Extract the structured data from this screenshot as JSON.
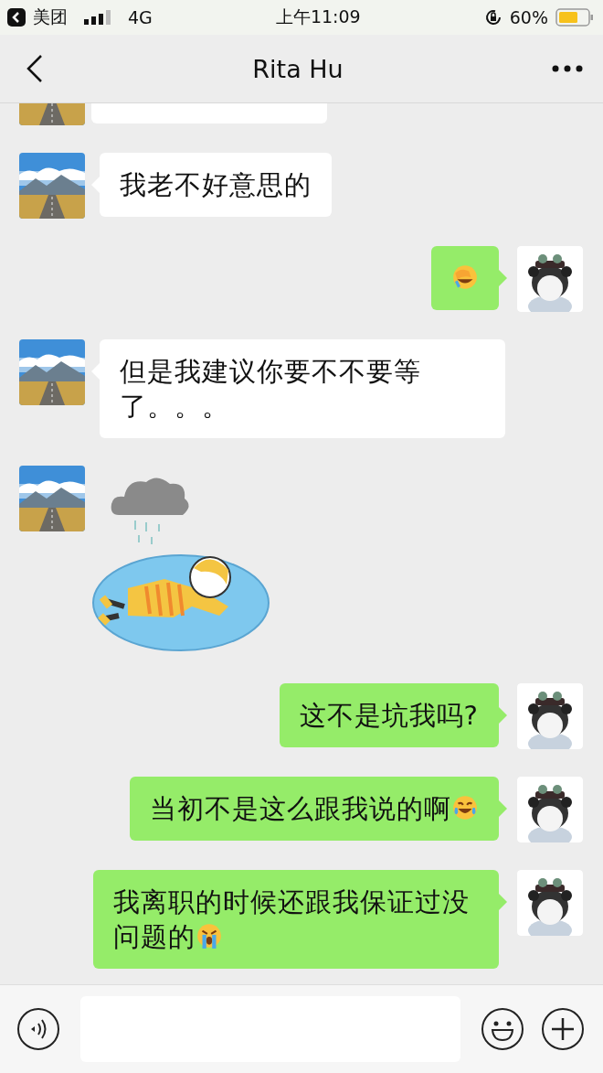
{
  "status_bar": {
    "back_app": "美团",
    "network": "4G",
    "time": "上午11:09",
    "battery": "60%"
  },
  "header": {
    "title": "Rita Hu"
  },
  "messages": [
    {
      "outgoing": false,
      "kind": "cut_off"
    },
    {
      "outgoing": false,
      "kind": "text",
      "text": "我老不好意思的"
    },
    {
      "outgoing": true,
      "kind": "text",
      "emoji": {
        "kind": "facepalm"
      }
    },
    {
      "outgoing": false,
      "kind": "text",
      "text": "但是我建议你要不不要等了。。。"
    },
    {
      "outgoing": false,
      "kind": "sticker"
    },
    {
      "outgoing": true,
      "kind": "text",
      "text": "这不是坑我吗?"
    },
    {
      "outgoing": true,
      "kind": "text",
      "text": "当初不是这么跟我说的啊",
      "emoji": {
        "kind": "laughing"
      }
    },
    {
      "outgoing": true,
      "kind": "text",
      "text": "我离职的时候还跟我保证过没问题的",
      "emoji": {
        "kind": "crying"
      }
    }
  ]
}
